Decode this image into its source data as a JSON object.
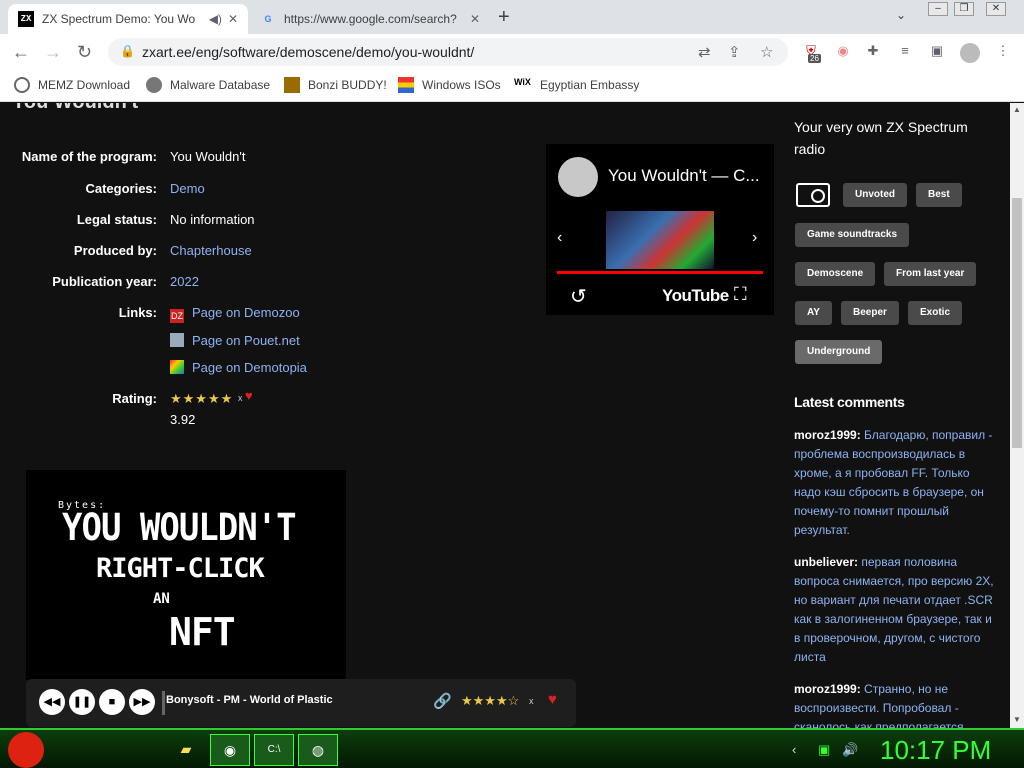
{
  "browser": {
    "tabs": [
      {
        "title": "ZX Spectrum Demo: You Wo",
        "favicon": "zx-spectrum-icon",
        "audio": true
      },
      {
        "title": "https://www.google.com/search?",
        "favicon": "google-icon"
      }
    ],
    "url": "zxart.ee/eng/software/demoscene/demo/you-wouldnt/",
    "extension_badge": "26",
    "bookmarks": [
      {
        "label": "MEMZ Download"
      },
      {
        "label": "Malware Database"
      },
      {
        "label": "Bonzi BUDDY!"
      },
      {
        "label": "Windows ISOs"
      },
      {
        "label": "Egyptian Embassy"
      }
    ]
  },
  "page": {
    "title": "You Wouldn't",
    "info": {
      "name_label": "Name of the program:",
      "name_value": "You Wouldn't",
      "categories_label": "Categories:",
      "categories_value": "Demo",
      "legal_label": "Legal status:",
      "legal_value": "No information",
      "produced_label": "Produced by:",
      "produced_value": "Chapterhouse",
      "year_label": "Publication year:",
      "year_value": "2022",
      "links_label": "Links:",
      "links": [
        "Page on Demozoo",
        "Page on Pouet.net",
        "Page on Demotopia"
      ],
      "rating_label": "Rating:",
      "rating_value": "3.92",
      "rating_stars": "★★★★★",
      "rating_x": "x"
    },
    "video": {
      "title": "You Wouldn't — C...",
      "logo": "YouTube"
    },
    "screen_image": {
      "bytes": "Bytes:",
      "line1": "YOU WOULDN'T",
      "line2": "RIGHT-CLICK",
      "line3": "AN",
      "line4": "NFT"
    },
    "player": {
      "track": "Bonysoft - PM - World of Plastic",
      "stars": "★★★★☆",
      "x": "x"
    },
    "sidebar": {
      "radio_title": "Your very own ZX Spectrum radio",
      "radio_buttons": [
        "Unvoted",
        "Best",
        "Game soundtracks",
        "Demoscene",
        "From last year",
        "AY",
        "Beeper",
        "Exotic",
        "Underground"
      ],
      "latest_title": "Latest comments",
      "comments": [
        {
          "user": "moroz1999:",
          "text": "Благодарю, поправил - проблема воспроизводилась в хроме, а я пробовал FF. Только надо кэш сбросить в браузере, он почему-то помнит прошлый результат."
        },
        {
          "user": "unbeliever:",
          "text": "первая половина вопроса снимается, про версию 2X, но вариант для печати отдает .SCR как в залогиненном браузере, так и в проверочном, другом, с чистого листа"
        },
        {
          "user": "moroz1999:",
          "text": "Странно, но не воспроизвести. Попробовал - сканолось как предполагается"
        }
      ]
    }
  },
  "taskbar": {
    "clock": "10:17 PM"
  }
}
